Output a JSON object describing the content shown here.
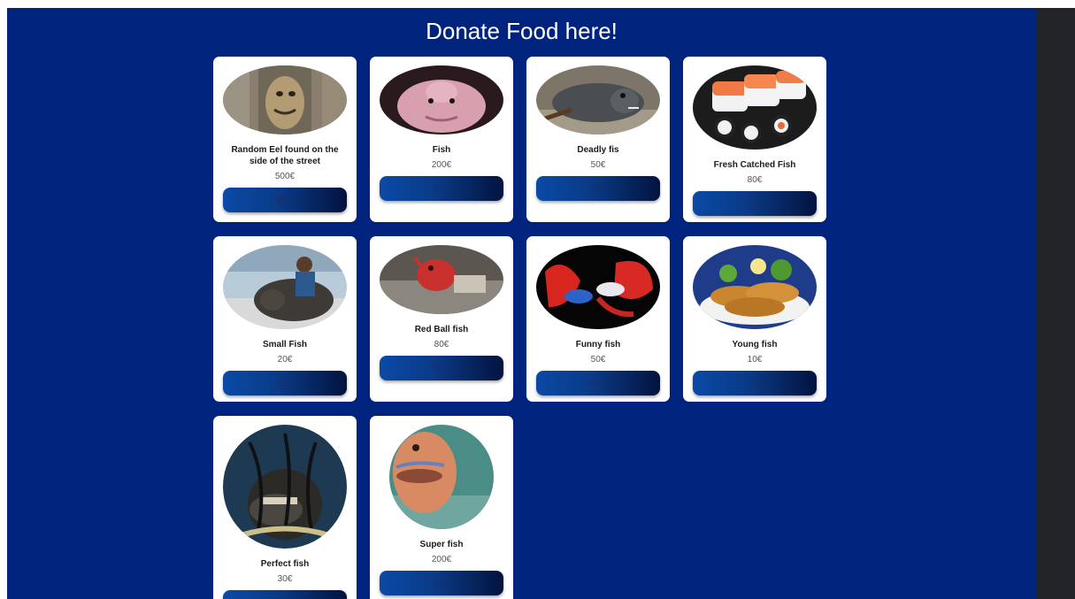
{
  "title": "Donate Food here!",
  "products": [
    {
      "name": "Random Eel found on the side of the street",
      "price": "500€",
      "buy_label": "Buy"
    },
    {
      "name": "Fish",
      "price": "200€",
      "buy_label": "Buy"
    },
    {
      "name": "Deadly fis",
      "price": "50€",
      "buy_label": "Buy"
    },
    {
      "name": "Fresh Catched Fish",
      "price": "80€",
      "buy_label": "Buy"
    },
    {
      "name": "Small Fish",
      "price": "20€",
      "buy_label": "Buy"
    },
    {
      "name": "Red Ball fish",
      "price": "80€",
      "buy_label": "Buy"
    },
    {
      "name": "Funny fish",
      "price": "50€",
      "buy_label": "Buy"
    },
    {
      "name": "Young fish",
      "price": "10€",
      "buy_label": "Buy"
    },
    {
      "name": "Perfect fish",
      "price": "30€",
      "buy_label": "Buy"
    },
    {
      "name": "Super fish",
      "price": "200€",
      "buy_label": "Buy"
    }
  ]
}
